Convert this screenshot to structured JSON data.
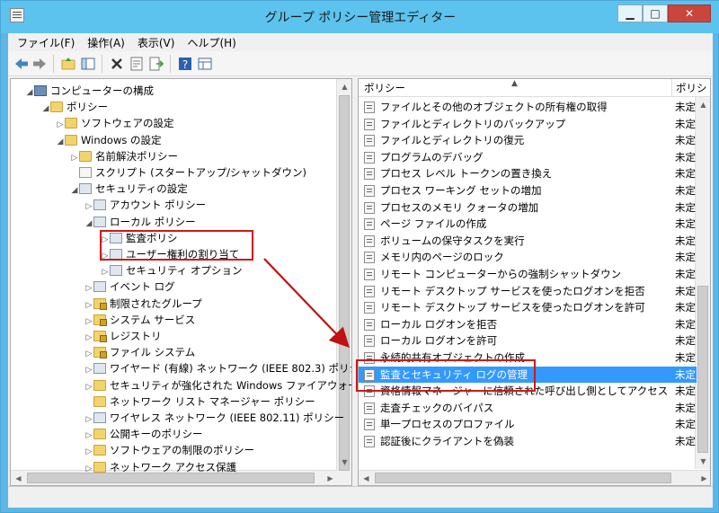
{
  "window": {
    "title": "グループ ポリシー管理エディター",
    "controls": {
      "minimize": "▁",
      "maximize": "□",
      "close": "✕"
    }
  },
  "menu": [
    "ファイル(F)",
    "操作(A)",
    "表示(V)",
    "ヘルプ(H)"
  ],
  "tree": [
    {
      "label": "コンピューターの構成",
      "icon": "computer-icon",
      "expander": "expanded"
    },
    {
      "label": "ポリシー",
      "icon": "folder-icon",
      "expander": "expanded"
    },
    {
      "label": "ソフトウェアの設定",
      "icon": "folder-icon",
      "expander": "collapsed"
    },
    {
      "label": "Windows の設定",
      "icon": "folder-icon",
      "expander": "expanded"
    },
    {
      "label": "名前解決ポリシー",
      "icon": "folder-icon",
      "expander": "collapsed"
    },
    {
      "label": "スクリプト (スタートアップ/シャットダウン)",
      "icon": "script-icon",
      "expander": "none"
    },
    {
      "label": "セキュリティの設定",
      "icon": "policy-icon",
      "expander": "expanded"
    },
    {
      "label": "アカウント ポリシー",
      "icon": "policy-icon",
      "expander": "collapsed"
    },
    {
      "label": "ローカル ポリシー",
      "icon": "policy-icon",
      "expander": "expanded"
    },
    {
      "label": "監査ポリシ",
      "icon": "policy-icon",
      "expander": "collapsed"
    },
    {
      "label": "ユーザー権利の割り当て",
      "icon": "policy-icon",
      "expander": "collapsed"
    },
    {
      "label": "セキュリティ オプション",
      "icon": "policy-icon",
      "expander": "collapsed"
    },
    {
      "label": "イベント ログ",
      "icon": "policy-icon",
      "expander": "collapsed"
    },
    {
      "label": "制限されたグループ",
      "icon": "locked-folder-icon",
      "expander": "collapsed"
    },
    {
      "label": "システム サービス",
      "icon": "locked-folder-icon",
      "expander": "collapsed"
    },
    {
      "label": "レジストリ",
      "icon": "locked-folder-icon",
      "expander": "collapsed"
    },
    {
      "label": "ファイル システム",
      "icon": "locked-folder-icon",
      "expander": "collapsed"
    },
    {
      "label": "ワイヤード (有線) ネットワーク (IEEE 802.3) ポリシ",
      "icon": "policy-icon",
      "expander": "collapsed"
    },
    {
      "label": "セキュリティが強化された Windows ファイアウォール",
      "icon": "folder-icon",
      "expander": "collapsed"
    },
    {
      "label": "ネットワーク リスト マネージャー ポリシー",
      "icon": "folder-icon",
      "expander": "none"
    },
    {
      "label": "ワイヤレス ネットワーク (IEEE 802.11) ポリシー",
      "icon": "policy-icon",
      "expander": "collapsed"
    },
    {
      "label": "公開キーのポリシー",
      "icon": "folder-icon",
      "expander": "collapsed"
    },
    {
      "label": "ソフトウェアの制限のポリシー",
      "icon": "folder-icon",
      "expander": "collapsed"
    },
    {
      "label": "ネットワーク アクセス保護",
      "icon": "folder-icon",
      "expander": "collapsed"
    }
  ],
  "policy_table": {
    "headers": [
      "ポリシー",
      "ポリシ"
    ],
    "rows": [
      {
        "name": "ファイルとその他のオブジェクトの所有権の取得",
        "value": "未定"
      },
      {
        "name": "ファイルとディレクトリのバックアップ",
        "value": "未定"
      },
      {
        "name": "ファイルとディレクトリの復元",
        "value": "未定"
      },
      {
        "name": "プログラムのデバッグ",
        "value": "未定"
      },
      {
        "name": "プロセス レベル トークンの置き換え",
        "value": "未定"
      },
      {
        "name": "プロセス ワーキング セットの増加",
        "value": "未定"
      },
      {
        "name": "プロセスのメモリ クォータの増加",
        "value": "未定"
      },
      {
        "name": "ページ ファイルの作成",
        "value": "未定"
      },
      {
        "name": "ボリュームの保守タスクを実行",
        "value": "未定"
      },
      {
        "name": "メモリ内のページのロック",
        "value": "未定"
      },
      {
        "name": "リモート コンピューターからの強制シャットダウン",
        "value": "未定"
      },
      {
        "name": "リモート デスクトップ サービスを使ったログオンを拒否",
        "value": "未定"
      },
      {
        "name": "リモート デスクトップ サービスを使ったログオンを許可",
        "value": "未定"
      },
      {
        "name": "ローカル ログオンを拒否",
        "value": "未定"
      },
      {
        "name": "ローカル ログオンを許可",
        "value": "未定"
      },
      {
        "name": "永続的共有オブジェクトの作成",
        "value": "未定"
      },
      {
        "name": "監査とセキュリティ ログの管理",
        "value": "未定",
        "selected": true
      },
      {
        "name": "資格情報マネージャーに信頼された呼び出し側としてアクセス",
        "value": "未定"
      },
      {
        "name": "走査チェックのバイパス",
        "value": "未定"
      },
      {
        "name": "単一プロセスのプロファイル",
        "value": "未定"
      },
      {
        "name": "認証後にクライアントを偽装",
        "value": "未定"
      }
    ]
  },
  "colors": {
    "selection": "#3399ff",
    "annotation": "#d01818",
    "titlebar": "#5cc3ee"
  }
}
